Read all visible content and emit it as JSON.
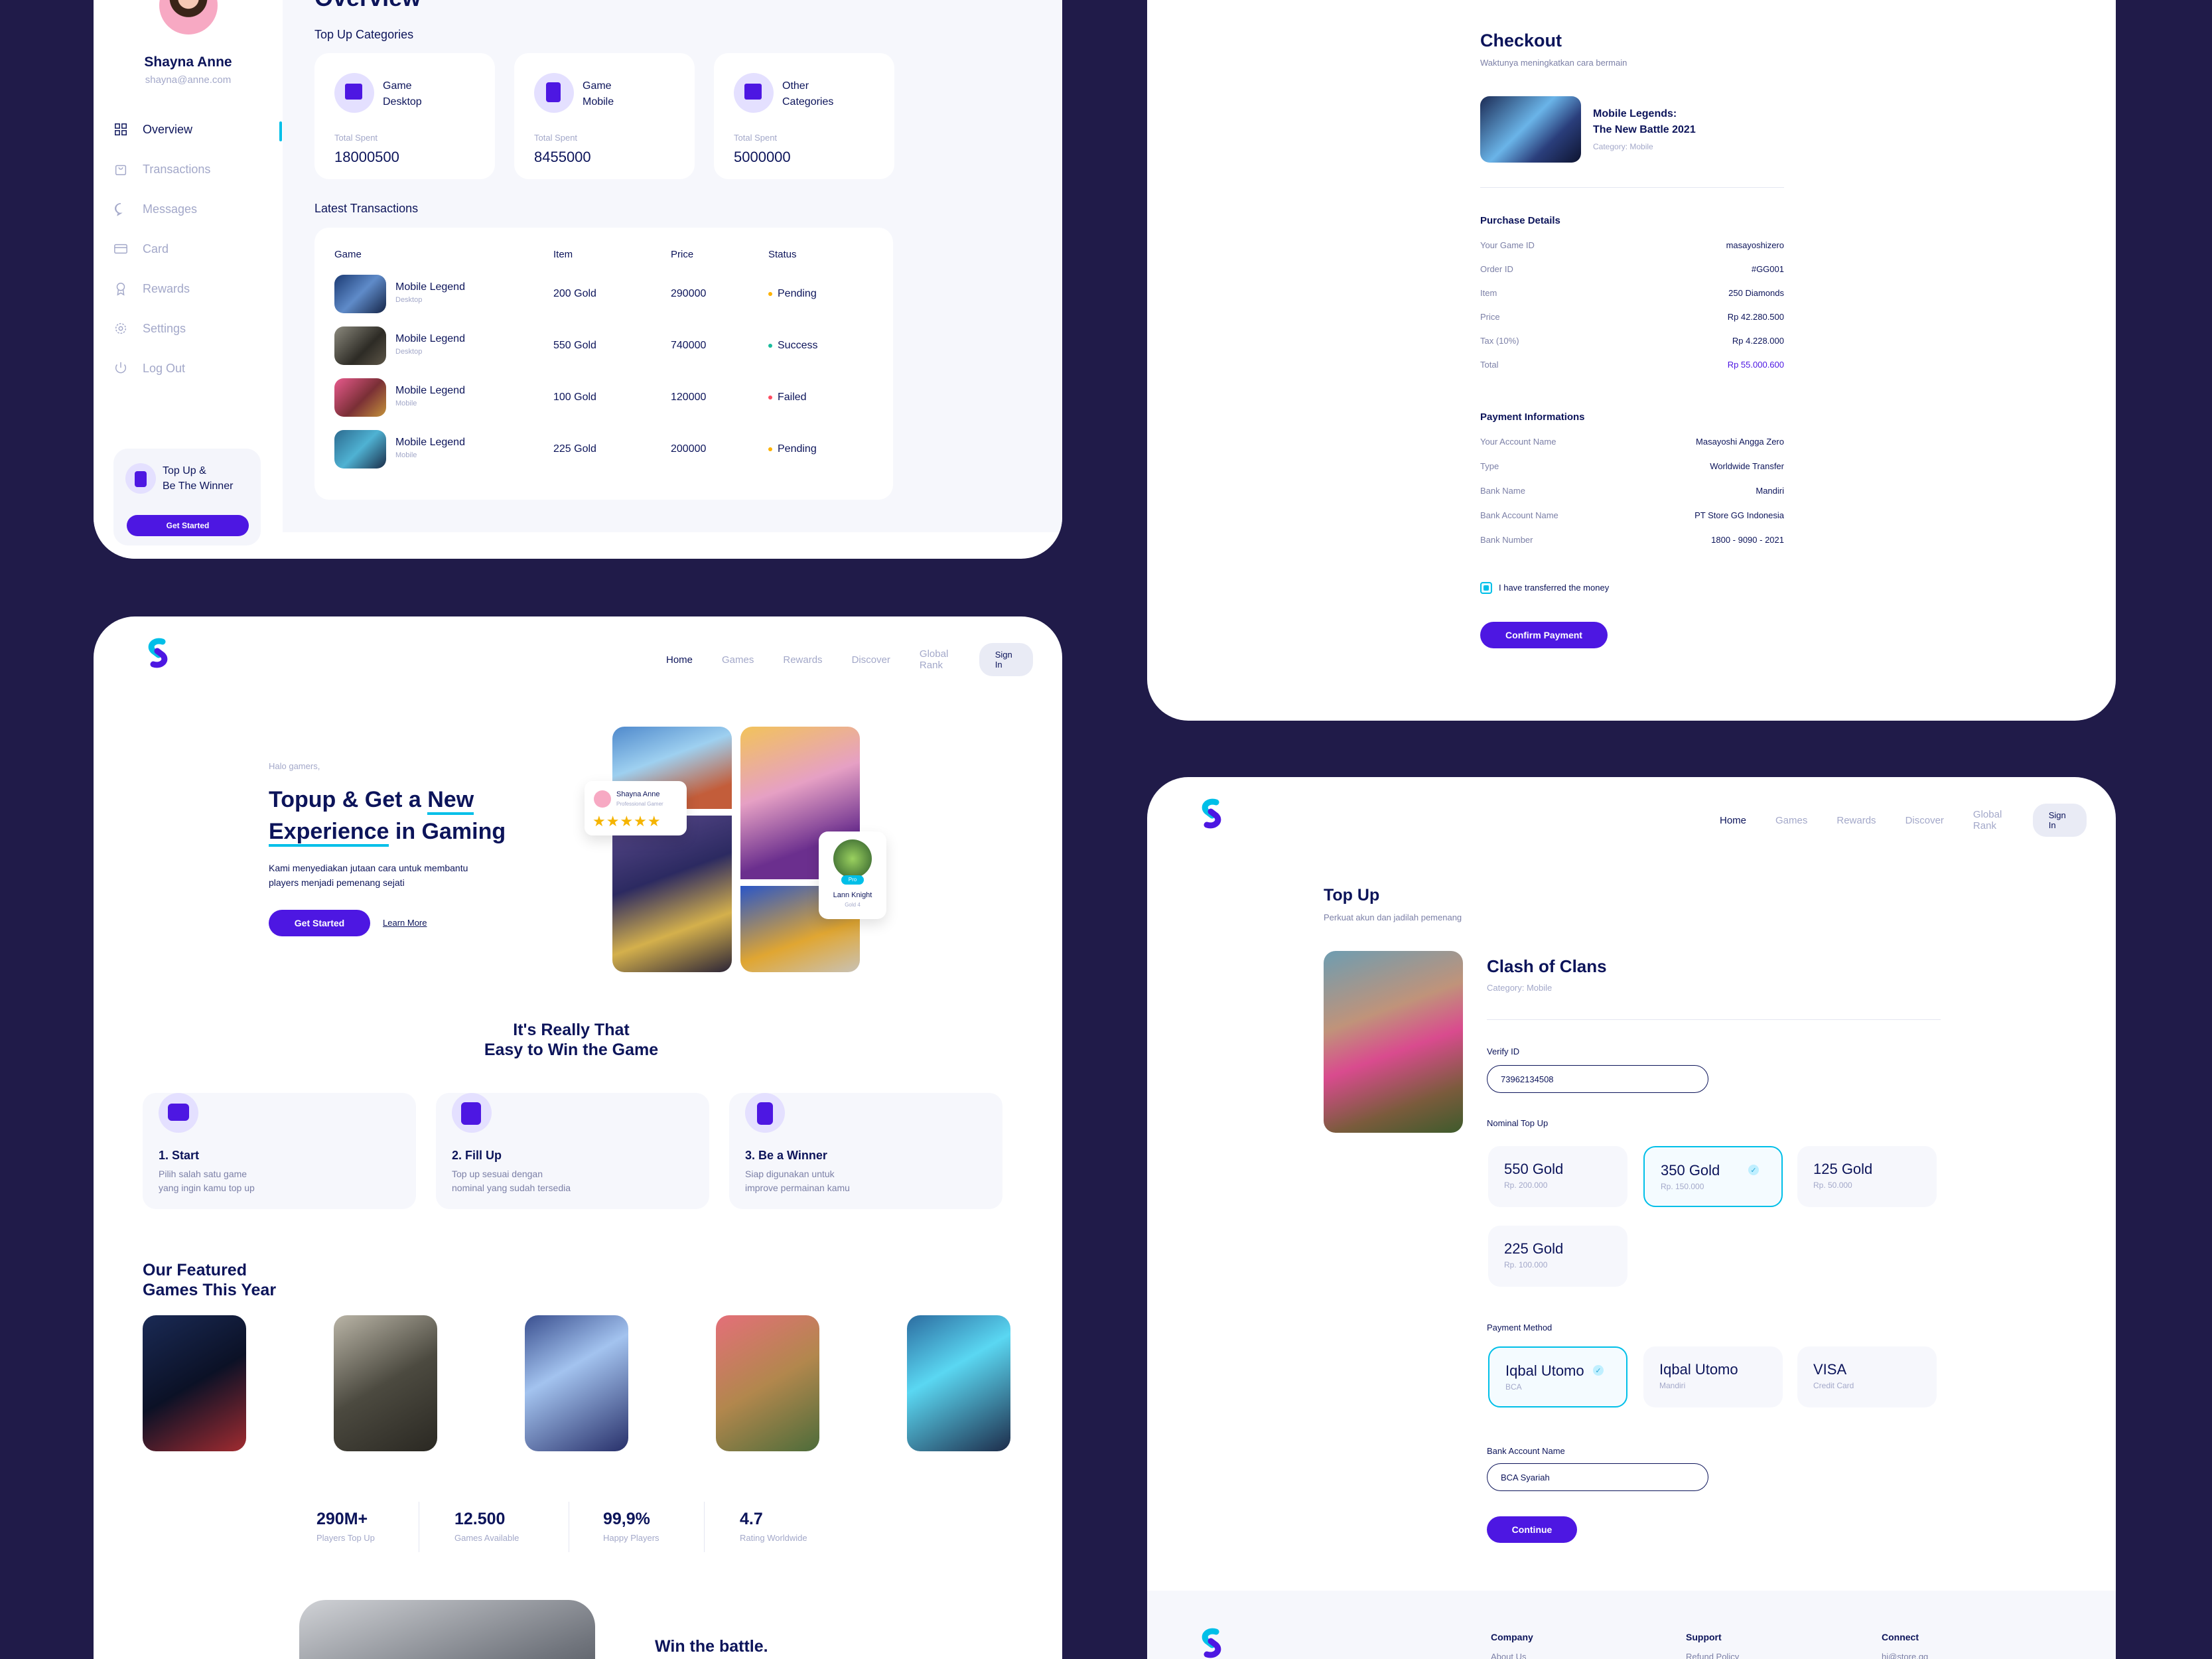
{
  "dashboard": {
    "user": {
      "name": "Shayna Anne",
      "email": "shayna@anne.com"
    },
    "menu": [
      "Overview",
      "Transactions",
      "Messages",
      "Card",
      "Rewards",
      "Settings",
      "Log Out"
    ],
    "promo": {
      "title_line1": "Top Up &",
      "title_line2": "Be The Winner",
      "button": "Get Started"
    },
    "page_title": "Overview",
    "categories_title": "Top Up Categories",
    "categories": [
      {
        "line1": "Game",
        "line2": "Desktop",
        "label": "Total Spent",
        "value": "18000500"
      },
      {
        "line1": "Game",
        "line2": "Mobile",
        "label": "Total Spent",
        "value": "8455000"
      },
      {
        "line1": "Other",
        "line2": "Categories",
        "label": "Total Spent",
        "value": "5000000"
      }
    ],
    "transactions_title": "Latest Transactions",
    "columns": [
      "Game",
      "Item",
      "Price",
      "Status"
    ],
    "rows": [
      {
        "game": "Mobile Legend",
        "platform": "Desktop",
        "item": "200 Gold",
        "price": "290000",
        "status": "Pending"
      },
      {
        "game": "Mobile Legend",
        "platform": "Desktop",
        "item": "550 Gold",
        "price": "740000",
        "status": "Success"
      },
      {
        "game": "Mobile Legend",
        "platform": "Mobile",
        "item": "100 Gold",
        "price": "120000",
        "status": "Failed"
      },
      {
        "game": "Mobile Legend",
        "platform": "Mobile",
        "item": "225 Gold",
        "price": "200000",
        "status": "Pending"
      }
    ],
    "status_colors": {
      "Pending": "#feb200",
      "Success": "#1abc9c",
      "Failed": "#fe4c62"
    }
  },
  "checkout": {
    "title": "Checkout",
    "subtitle": "Waktunya meningkatkan cara bermain",
    "game_title_line1": "Mobile Legends:",
    "game_title_line2": "The New Battle 2021",
    "game_category": "Category: Mobile",
    "purchase_title": "Purchase Details",
    "purchase": [
      {
        "k": "Your Game ID",
        "v": "masayoshizero"
      },
      {
        "k": "Order ID",
        "v": "#GG001"
      },
      {
        "k": "Item",
        "v": "250 Diamonds"
      },
      {
        "k": "Price",
        "v": "Rp 42.280.500"
      },
      {
        "k": "Tax (10%)",
        "v": "Rp 4.228.000"
      },
      {
        "k": "Total",
        "v": "Rp 55.000.600"
      }
    ],
    "payment_title": "Payment Informations",
    "payment": [
      {
        "k": "Your Account Name",
        "v": "Masayoshi Angga Zero"
      },
      {
        "k": "Type",
        "v": "Worldwide Transfer"
      },
      {
        "k": "Bank Name",
        "v": "Mandiri"
      },
      {
        "k": "Bank Account Name",
        "v": "PT Store GG Indonesia"
      },
      {
        "k": "Bank Number",
        "v": "1800 - 9090 - 2021"
      }
    ],
    "checkbox_label": "I have transferred the money",
    "button": "Confirm Payment"
  },
  "nav": {
    "links": [
      "Home",
      "Games",
      "Rewards",
      "Discover",
      "Global Rank"
    ],
    "signin": "Sign In"
  },
  "landing": {
    "greeting": "Halo gamers,",
    "hero_line1_a": "Topup & Get a ",
    "hero_line1_b": "New",
    "hero_line2_a": "Experience",
    "hero_line2_b": " in Gaming",
    "hero_desc_line1": "Kami menyediakan jutaan cara untuk membantu",
    "hero_desc_line2": "players menjadi pemenang sejati",
    "cta": "Get Started",
    "learn": "Learn More",
    "card_user": {
      "name": "Shayna Anne",
      "role": "Professional Gamer",
      "stars": "★★★★★"
    },
    "card_player": {
      "name": "Lann Knight",
      "role": "Gold 4",
      "badge": "Pro"
    },
    "steps_title_line1": "It's Really That",
    "steps_title_line2": "Easy to Win the Game",
    "steps": [
      {
        "title": "1. Start",
        "d1": "Pilih salah satu game",
        "d2": "yang ingin kamu top up"
      },
      {
        "title": "2. Fill Up",
        "d1": "Top up sesuai dengan",
        "d2": "nominal yang sudah tersedia"
      },
      {
        "title": "3. Be a Winner",
        "d1": "Siap digunakan untuk",
        "d2": "improve permainan kamu"
      }
    ],
    "featured_line1": "Our Featured",
    "featured_line2": "Games This Year",
    "stats": [
      {
        "n": "290M+",
        "l": "Players Top Up"
      },
      {
        "n": "12.500",
        "l": "Games Available"
      },
      {
        "n": "99,9%",
        "l": "Happy Players"
      },
      {
        "n": "4.7",
        "l": "Rating Worldwide"
      }
    ],
    "win_title": "Win the battle."
  },
  "topup": {
    "title": "Top Up",
    "subtitle": "Perkuat akun dan jadilah pemenang",
    "game": "Clash of Clans",
    "category": "Category: Mobile",
    "verify_label": "Verify ID",
    "verify_value": "73962134508",
    "nominal_label": "Nominal Top Up",
    "nominals": [
      {
        "a": "550 Gold",
        "b": "Rp. 200.000"
      },
      {
        "a": "350 Gold",
        "b": "Rp. 150.000"
      },
      {
        "a": "125 Gold",
        "b": "Rp. 50.000"
      },
      {
        "a": "225 Gold",
        "b": "Rp. 100.000"
      }
    ],
    "method_label": "Payment Method",
    "methods": [
      {
        "a": "Iqbal Utomo",
        "b": "BCA"
      },
      {
        "a": "Iqbal Utomo",
        "b": "Mandiri"
      },
      {
        "a": "VISA",
        "b": "Credit Card"
      }
    ],
    "bank_label": "Bank Account Name",
    "bank_value": "BCA Syariah",
    "button": "Continue",
    "footer": {
      "cols": [
        "Company",
        "Support",
        "Connect"
      ],
      "links": [
        "About Us",
        "Refund Policy",
        "hi@store.gg"
      ]
    }
  }
}
